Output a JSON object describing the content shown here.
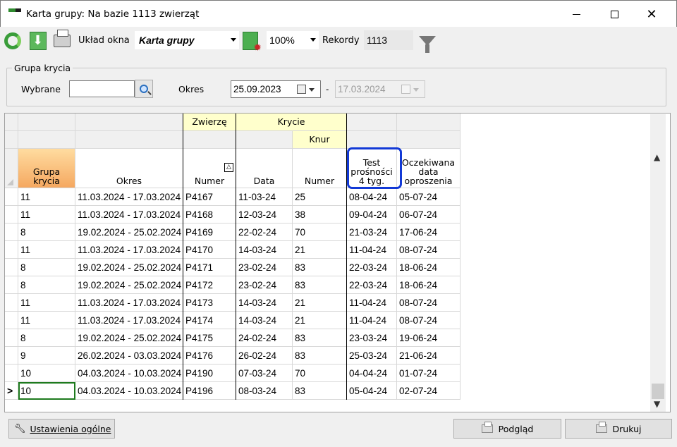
{
  "window": {
    "title": "Karta grupy: Na bazie 1113 zwierząt"
  },
  "toolbar": {
    "layout_label": "Układ okna",
    "layout_value": "Karta grupy",
    "zoom_value": "100%",
    "records_label": "Rekordy",
    "records_value": "1113"
  },
  "filter_group": {
    "title": "Grupa krycia",
    "selected_label": "Wybrane",
    "selected_value": "",
    "period_label": "Okres",
    "date_from": "25.09.2023",
    "date_to": "17.03.2024"
  },
  "grid": {
    "groups": {
      "animal": "Zwierzę",
      "mating": "Krycie",
      "boar": "Knur"
    },
    "columns": {
      "group": "Grupa krycia",
      "period": "Okres",
      "number": "Numer",
      "date": "Data",
      "boar_number": "Numer",
      "test": "Test prośności 4 tyg.",
      "expected": "Oczekiwana data oproszenia"
    },
    "current_row_marker": ">",
    "rows": [
      [
        "11",
        "11.03.2024 - 17.03.2024",
        "P4167",
        "11-03-24",
        "25",
        "08-04-24",
        "05-07-24"
      ],
      [
        "11",
        "11.03.2024 - 17.03.2024",
        "P4168",
        "12-03-24",
        "38",
        "09-04-24",
        "06-07-24"
      ],
      [
        "8",
        "19.02.2024 - 25.02.2024",
        "P4169",
        "22-02-24",
        "70",
        "21-03-24",
        "17-06-24"
      ],
      [
        "11",
        "11.03.2024 - 17.03.2024",
        "P4170",
        "14-03-24",
        "21",
        "11-04-24",
        "08-07-24"
      ],
      [
        "8",
        "19.02.2024 - 25.02.2024",
        "P4171",
        "23-02-24",
        "83",
        "22-03-24",
        "18-06-24"
      ],
      [
        "8",
        "19.02.2024 - 25.02.2024",
        "P4172",
        "23-02-24",
        "83",
        "22-03-24",
        "18-06-24"
      ],
      [
        "11",
        "11.03.2024 - 17.03.2024",
        "P4173",
        "14-03-24",
        "21",
        "11-04-24",
        "08-07-24"
      ],
      [
        "11",
        "11.03.2024 - 17.03.2024",
        "P4174",
        "14-03-24",
        "21",
        "11-04-24",
        "08-07-24"
      ],
      [
        "8",
        "19.02.2024 - 25.02.2024",
        "P4175",
        "24-02-24",
        "83",
        "23-03-24",
        "19-06-24"
      ],
      [
        "9",
        "26.02.2024 - 03.03.2024",
        "P4176",
        "26-02-24",
        "83",
        "25-03-24",
        "21-06-24"
      ],
      [
        "10",
        "04.03.2024 - 10.03.2024",
        "P4190",
        "07-03-24",
        "70",
        "04-04-24",
        "01-07-24"
      ],
      [
        "10",
        "04.03.2024 - 10.03.2024",
        "P4196",
        "08-03-24",
        "83",
        "05-04-24",
        "02-07-24"
      ]
    ]
  },
  "footer": {
    "settings_button": "Ustawienia ogólne",
    "preview_button": "Podgląd",
    "print_button": "Drukuj"
  },
  "colors": {
    "accent_highlight": "#1239d6",
    "header_yellow": "#ffffcc",
    "sort_header": "#f5a860",
    "current_cell": "#1e7a1e"
  }
}
